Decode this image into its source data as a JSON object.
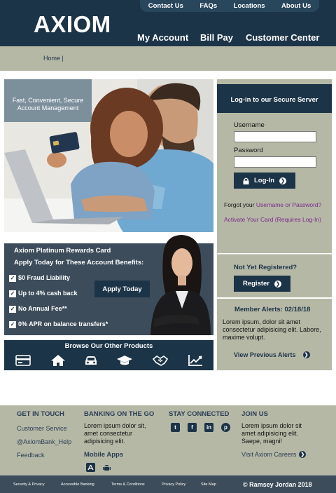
{
  "header": {
    "logo": "AXIOM",
    "top_links": [
      "Contact Us",
      "FAQs",
      "Locations",
      "About Us"
    ],
    "main_nav": [
      "My Account",
      "Bill Pay",
      "Customer Center"
    ]
  },
  "breadcrumb": "Home |",
  "hero": {
    "promo_text": "Fast, Convenient, Secure Account Management"
  },
  "login": {
    "title": "Log-in to our Secure Server",
    "username_label": "Username",
    "username_value": "",
    "password_label": "Password",
    "password_value": "",
    "login_button": "Log-In",
    "forgot_prefix": "Forgot your ",
    "forgot_link": "Username or Password?",
    "activate_link": "Activate Your Card (Requires Log-In)"
  },
  "register": {
    "title": "Not Yet Registered?",
    "button": "Register"
  },
  "alerts": {
    "title": "Member Alerts: 02/18/18",
    "body": "Lorem ipsum, dolor sit amet consectetur adipisicing elit. Labore, maxime volupt.",
    "link": "View Previous Alerts"
  },
  "rewards": {
    "title": "Axiom Platinum Rewards Card",
    "subtitle": "Apply Today for These Account Benefits:",
    "benefits": [
      "$0 Fraud Liability",
      "Up to 4% cash back",
      "No Annual Fee**",
      "0% APR on balance transfers*"
    ],
    "apply_button": "Apply Today"
  },
  "browse": {
    "title": "Browse Our Other Products",
    "icons": [
      "credit-card-icon",
      "home-icon",
      "car-icon",
      "graduation-cap-icon",
      "handshake-icon",
      "chart-icon"
    ]
  },
  "footer": {
    "get_in_touch": {
      "title": "GET IN TOUCH",
      "links": [
        "Customer Service",
        "@AxiomBank_Help",
        "Feedback"
      ]
    },
    "banking": {
      "title": "BANKING ON THE GO",
      "text": "Lorem ipsum dolor sit, amet consectetur adipisicing elit.",
      "apps_label": "Mobile Apps"
    },
    "stay_connected": {
      "title": "STAY CONNECTED",
      "icons": [
        "twitter-icon",
        "facebook-icon",
        "linkedin-icon",
        "pinterest-icon"
      ]
    },
    "join_us": {
      "title": "JOIN US",
      "text": "Lorem ipsum dolor sit amet adipisicing elit. Saepe, magni!",
      "link": "Visit Axiom Careers"
    },
    "bottom_links": [
      "Security & Privacy",
      "Accessible Banking",
      "Terms & Conditions",
      "Privacy Policy",
      "Site Map"
    ],
    "copyright": "© Ramsey Jordan 2018"
  },
  "colors": {
    "navy": "#1c3447",
    "sage": "#b6b8a6",
    "slate": "#3d4c5a",
    "link_purple": "#7a2a8c"
  }
}
